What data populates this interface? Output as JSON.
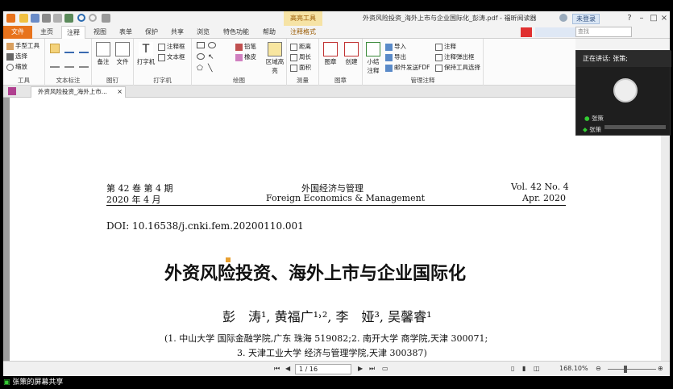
{
  "titlebar": {
    "context_tool": "高亮工具",
    "title": "外资风险投资_海外上市与企业国际化_彭涛.pdf - 福昕阅读器",
    "login": "未登录",
    "search_placeholder": "查找"
  },
  "menu": {
    "tabs": [
      "文件",
      "主页",
      "注释",
      "视图",
      "表单",
      "保护",
      "共享",
      "浏览",
      "特色功能",
      "帮助",
      "注释格式"
    ],
    "active": "注释"
  },
  "ribbon": {
    "groups": {
      "tools": {
        "label": "工具",
        "items": [
          "手型工具",
          "选择",
          "缩放"
        ]
      },
      "text_markup": {
        "label": "文本标注"
      },
      "pin": {
        "label": "图钉",
        "items": [
          "备注",
          "文件"
        ]
      },
      "typewriter": {
        "label": "打字机",
        "items": [
          "打字机",
          "注释框",
          "文本框"
        ]
      },
      "drawing": {
        "label": "绘图",
        "items": [
          "铅笔",
          "橡皮",
          "区域高亮"
        ]
      },
      "measure": {
        "label": "测量",
        "items": [
          "距离",
          "周长",
          "面积"
        ]
      },
      "stamp": {
        "label": "图章",
        "items": [
          "图章",
          "创建"
        ]
      },
      "manage": {
        "label": "管理注释",
        "items": [
          "小结注释",
          "导入",
          "导出",
          "邮件发送FDF",
          "注释",
          "注释弹出框",
          "保持工具选择"
        ]
      }
    }
  },
  "document_tab": {
    "label": "外资风险投资_海外上市..."
  },
  "document": {
    "header_left_1": "第 42 卷 第 4 期",
    "header_left_2": "2020 年 4 月",
    "header_center_1": "外国经济与管理",
    "header_center_2": "Foreign Economics & Management",
    "header_right_1": "Vol. 42 No. 4",
    "header_right_2": "Apr.  2020",
    "doi": "DOI: 10.16538/j.cnki.fem.20200110.001",
    "title": "外资风险投资、海外上市与企业国际化",
    "authors": "彭　涛¹, 黄福广¹˒², 李　娅³, 吴馨睿¹",
    "affiliation_1": "(1. 中山大学 国际金融学院,广东 珠海 519082;2. 南开大学 商学院,天津 300071;",
    "affiliation_2": "3. 天津工业大学 经济与管理学院,天津 300387)"
  },
  "statusbar": {
    "page": "1 / 16",
    "zoom": "168.10%"
  },
  "meeting": {
    "speaking_label": "正在讲话: 张策;",
    "speaker_name": "张策",
    "speaker_name_2": "张策"
  },
  "share_bar": {
    "label": "张策的屏幕共享"
  }
}
